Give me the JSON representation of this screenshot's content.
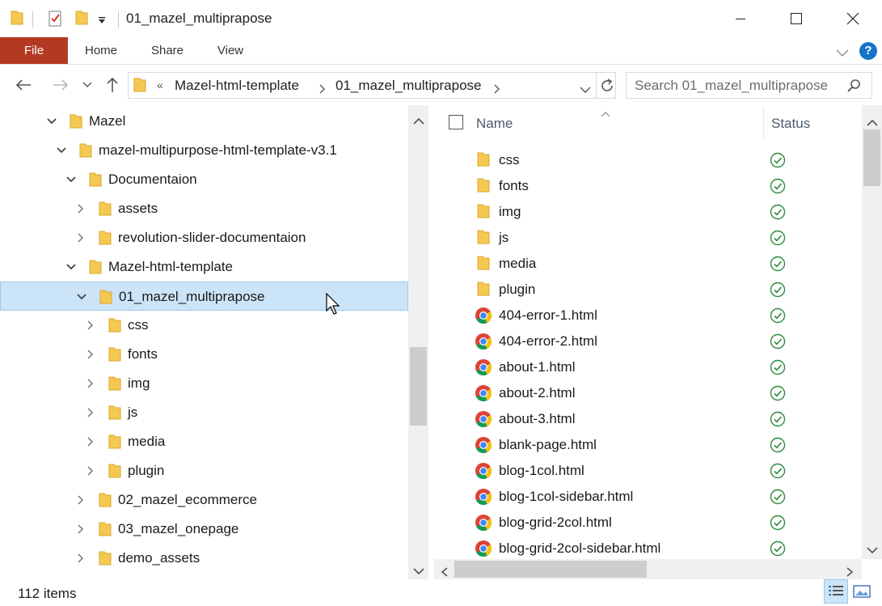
{
  "window": {
    "title": "01_mazel_multiprapose"
  },
  "ribbon": {
    "tabs": [
      {
        "label": "File"
      },
      {
        "label": "Home"
      },
      {
        "label": "Share"
      },
      {
        "label": "View"
      }
    ],
    "help_label": "?"
  },
  "address": {
    "overflow": "«",
    "crumbs": [
      {
        "label": "Mazel-html-template"
      },
      {
        "label": "01_mazel_multiprapose"
      }
    ]
  },
  "search": {
    "placeholder": "Search 01_mazel_multiprapose"
  },
  "tree": [
    {
      "label": "Mazel",
      "expanded": true,
      "selected": false
    },
    {
      "label": "mazel-multipurpose-html-template-v3.1",
      "expanded": true,
      "selected": false
    },
    {
      "label": "Documentaion",
      "expanded": true,
      "selected": false
    },
    {
      "label": "assets",
      "expanded": false,
      "selected": false
    },
    {
      "label": "revolution-slider-documentaion",
      "expanded": false,
      "selected": false
    },
    {
      "label": "Mazel-html-template",
      "expanded": true,
      "selected": false
    },
    {
      "label": "01_mazel_multiprapose",
      "expanded": true,
      "selected": true
    },
    {
      "label": "css",
      "expanded": false,
      "selected": false
    },
    {
      "label": "fonts",
      "expanded": false,
      "selected": false
    },
    {
      "label": "img",
      "expanded": false,
      "selected": false
    },
    {
      "label": "js",
      "expanded": false,
      "selected": false
    },
    {
      "label": "media",
      "expanded": false,
      "selected": false
    },
    {
      "label": "plugin",
      "expanded": false,
      "selected": false
    },
    {
      "label": "02_mazel_ecommerce",
      "expanded": false,
      "selected": false
    },
    {
      "label": "03_mazel_onepage",
      "expanded": false,
      "selected": false
    },
    {
      "label": "demo_assets",
      "expanded": false,
      "selected": false
    }
  ],
  "columns": {
    "name": "Name",
    "status": "Status"
  },
  "files": [
    {
      "name": "css",
      "type": "folder",
      "status": "synced"
    },
    {
      "name": "fonts",
      "type": "folder",
      "status": "synced"
    },
    {
      "name": "img",
      "type": "folder",
      "status": "synced"
    },
    {
      "name": "js",
      "type": "folder",
      "status": "synced"
    },
    {
      "name": "media",
      "type": "folder",
      "status": "synced"
    },
    {
      "name": "plugin",
      "type": "folder",
      "status": "synced"
    },
    {
      "name": "404-error-1.html",
      "type": "html",
      "status": "synced"
    },
    {
      "name": "404-error-2.html",
      "type": "html",
      "status": "synced"
    },
    {
      "name": "about-1.html",
      "type": "html",
      "status": "synced"
    },
    {
      "name": "about-2.html",
      "type": "html",
      "status": "synced"
    },
    {
      "name": "about-3.html",
      "type": "html",
      "status": "synced"
    },
    {
      "name": "blank-page.html",
      "type": "html",
      "status": "synced"
    },
    {
      "name": "blog-1col.html",
      "type": "html",
      "status": "synced"
    },
    {
      "name": "blog-1col-sidebar.html",
      "type": "html",
      "status": "synced"
    },
    {
      "name": "blog-grid-2col.html",
      "type": "html",
      "status": "synced"
    },
    {
      "name": "blog-grid-2col-sidebar.html",
      "type": "html",
      "status": "synced"
    }
  ],
  "statusbar": {
    "item_count": "112 items"
  },
  "colors": {
    "file_tab": "#b33a22",
    "selection": "#cce4f7",
    "selection_border": "#99c9ef",
    "folder": "#f5c951",
    "status_ok": "#2e8b3a",
    "help": "#1672c8"
  },
  "icons": {
    "folder": "folder-icon",
    "html": "chrome-icon",
    "status": "check-circle-icon"
  }
}
